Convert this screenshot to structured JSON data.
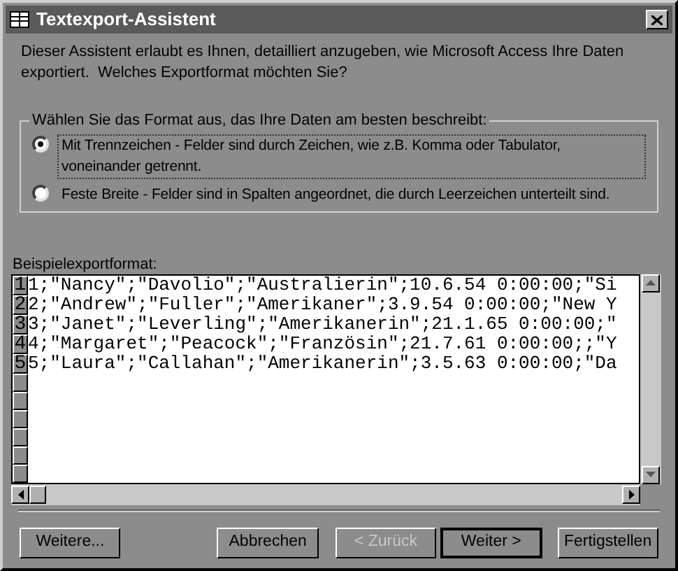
{
  "window": {
    "title": "Textexport-Assistent"
  },
  "intro": "Dieser Assistent erlaubt es Ihnen, detailliert anzugeben, wie Microsoft Access Ihre Daten exportiert.  Welches Exportformat möchten Sie?",
  "format_group": {
    "legend": "Wählen Sie das Format aus, das Ihre Daten am besten beschreibt:",
    "options": [
      {
        "label": "Mit Trennzeichen - Felder sind durch Zeichen, wie z.B. Komma oder Tabulator, voneinander getrennt.",
        "selected": true
      },
      {
        "label": "Feste Breite - Felder sind in Spalten angeordnet, die durch Leerzeichen unterteilt sind.",
        "selected": false
      }
    ]
  },
  "preview": {
    "label": "Beispielexportformat:",
    "rows": [
      {
        "number": "1",
        "text": "1;\"Nancy\";\"Davolio\";\"Australierin\";10.6.54 0:00:00;\"Si"
      },
      {
        "number": "2",
        "text": "2;\"Andrew\";\"Fuller\";\"Amerikaner\";3.9.54 0:00:00;\"New Y"
      },
      {
        "number": "3",
        "text": "3;\"Janet\";\"Leverling\";\"Amerikanerin\";21.1.65 0:00:00;\""
      },
      {
        "number": "4",
        "text": "4;\"Margaret\";\"Peacock\";\"Französin\";21.7.61 0:00:00;;\"Y"
      },
      {
        "number": "5",
        "text": "5;\"Laura\";\"Callahan\";\"Amerikanerin\";3.5.63 0:00:00;\"Da"
      }
    ]
  },
  "buttons": [
    {
      "label": "Weitere...",
      "disabled": false,
      "default": false
    },
    {
      "label": "Abbrechen",
      "disabled": false,
      "default": false
    },
    {
      "label": "< Zurück",
      "disabled": true,
      "default": false
    },
    {
      "label": "Weiter >",
      "disabled": false,
      "default": true
    },
    {
      "label": "Fertigstellen",
      "disabled": false,
      "default": false
    }
  ]
}
